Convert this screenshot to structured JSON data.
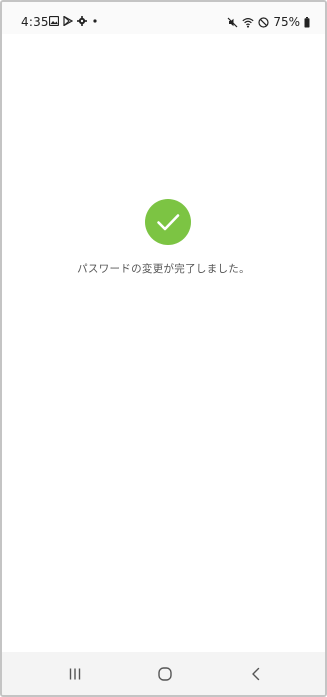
{
  "status_bar": {
    "time": "4:35",
    "battery": "75%",
    "left_icons": [
      "gallery-icon",
      "play-store-icon",
      "settings-icon",
      "dot-icon"
    ],
    "right_icons": [
      "mute-icon",
      "wifi-icon",
      "do-not-disturb-icon",
      "battery-icon"
    ]
  },
  "main": {
    "success_icon": "check-circle-icon",
    "message": "パスワードの変更が完了しました。"
  },
  "nav_bar": {
    "buttons": [
      "recents-icon",
      "home-icon",
      "back-icon"
    ]
  },
  "colors": {
    "success": "#7cc443",
    "message_text": "#555555",
    "nav_background": "#f4f4f4"
  }
}
